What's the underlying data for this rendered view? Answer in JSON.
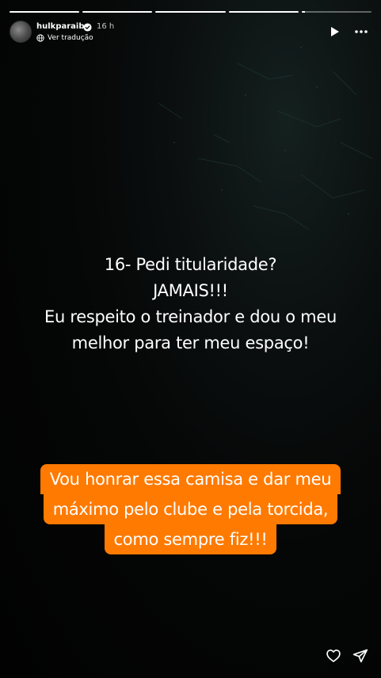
{
  "story": {
    "progress_segments": [
      1,
      1,
      1,
      1,
      0.05
    ],
    "header": {
      "username": "hulkparaiba",
      "time": "16 h",
      "translate_label": "Ver tradução"
    },
    "text_lines": [
      "16- Pedi titularidade?",
      "JAMAIS!!!",
      "Eu respeito o treinador e dou o meu",
      "melhor para ter meu espaço!"
    ],
    "callout_lines": [
      "Vou honrar essa camisa e dar meu",
      "máximo pelo clube e pela torcida,",
      "como sempre fiz!!!"
    ],
    "colors": {
      "callout_bg": "#ff7a00",
      "background": "#050606"
    },
    "icons": {
      "verified": "verified-badge-icon",
      "translate": "globe-icon",
      "play": "play-icon",
      "more": "more-dots-icon",
      "like": "heart-icon",
      "share": "send-icon"
    }
  }
}
